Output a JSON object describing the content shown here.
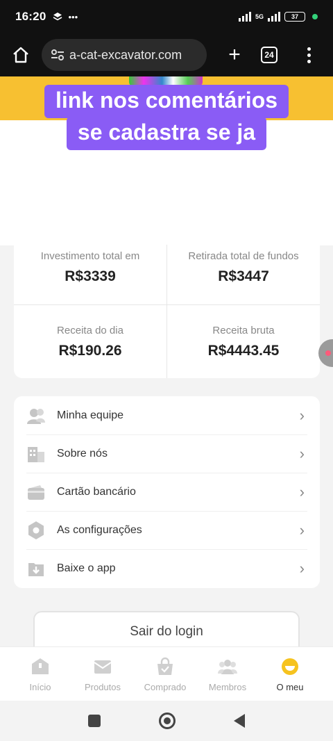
{
  "status_bar": {
    "time": "16:20",
    "network": "5G",
    "battery": "37"
  },
  "browser": {
    "url": "a-cat-excavator.com",
    "tab_count": "24"
  },
  "overlay": {
    "line1": "link nos comentários",
    "line2": "se cadastra se ja"
  },
  "stats": [
    {
      "label": "Investimento total em",
      "value": "R$3339"
    },
    {
      "label": "Retirada total de fundos",
      "value": "R$3447"
    },
    {
      "label": "Receita do dia",
      "value": "R$190.26"
    },
    {
      "label": "Receita bruta",
      "value": "R$4443.45"
    }
  ],
  "menu": [
    {
      "label": "Minha equipe",
      "icon": "team-icon"
    },
    {
      "label": "Sobre nós",
      "icon": "building-icon"
    },
    {
      "label": "Cartão bancário",
      "icon": "wallet-icon"
    },
    {
      "label": "As configurações",
      "icon": "hexagon-settings-icon"
    },
    {
      "label": "Baixe o app",
      "icon": "download-icon"
    }
  ],
  "logout_label": "Sair do login",
  "tabs": [
    {
      "label": "Início",
      "icon": "home-icon",
      "active": false
    },
    {
      "label": "Produtos",
      "icon": "envelope-icon",
      "active": false
    },
    {
      "label": "Comprado",
      "icon": "bag-icon",
      "active": false
    },
    {
      "label": "Membros",
      "icon": "members-icon",
      "active": false
    },
    {
      "label": "O meu",
      "icon": "smile-icon",
      "active": true
    }
  ],
  "colors": {
    "banner": "#f7c031",
    "overlay": "#8a5cf5",
    "active_tab": "#f6c31f",
    "inactive_icon": "#cfcfcf"
  }
}
